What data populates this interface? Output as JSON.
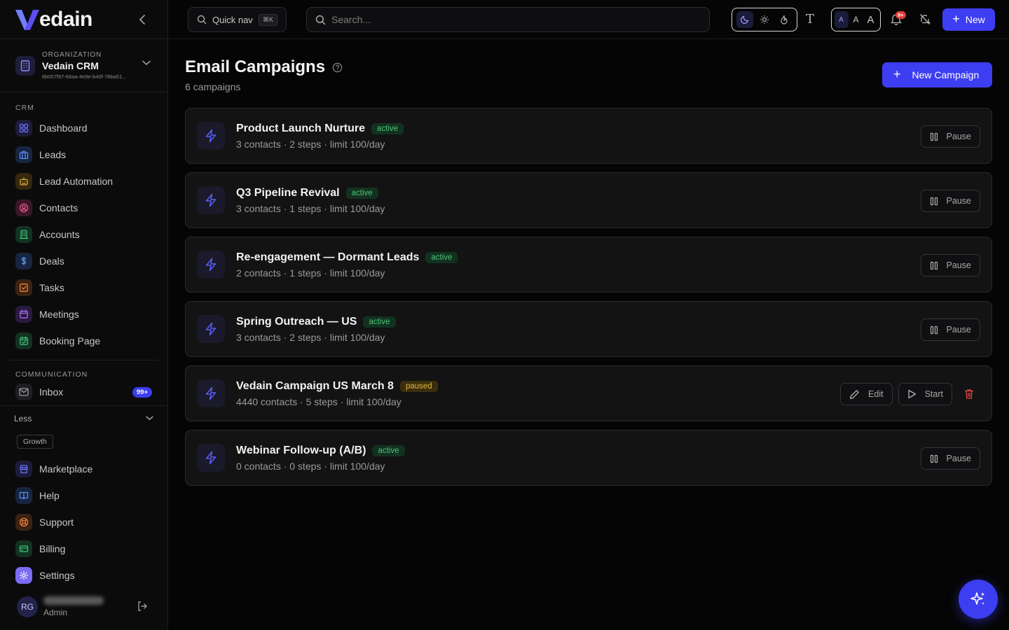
{
  "brand": {
    "logo_text": "edain"
  },
  "org": {
    "kicker": "ORGANIZATION",
    "name": "Vedain CRM",
    "id": "6b057f97-66aa-4e9e-b40f-78ba51..."
  },
  "sidebar": {
    "crm_label": "CRM",
    "crm_items": [
      {
        "label": "Dashboard",
        "icon": "dashboard-icon",
        "color": "#6b6ff5",
        "bg": "#1c1c3a"
      },
      {
        "label": "Leads",
        "icon": "briefcase-icon",
        "color": "#5b8def",
        "bg": "#172540"
      },
      {
        "label": "Lead Automation",
        "icon": "bot-icon",
        "color": "#e0a93a",
        "bg": "#35280e"
      },
      {
        "label": "Contacts",
        "icon": "contact-icon",
        "color": "#e05b8f",
        "bg": "#3a1726"
      },
      {
        "label": "Accounts",
        "icon": "building-icon",
        "color": "#3fc07d",
        "bg": "#123222"
      },
      {
        "label": "Deals",
        "icon": "dollar-icon",
        "color": "#5b9cf0",
        "bg": "#172540"
      },
      {
        "label": "Tasks",
        "icon": "task-icon",
        "color": "#f0803d",
        "bg": "#3a2212"
      },
      {
        "label": "Meetings",
        "icon": "calendar-icon",
        "color": "#a26bf0",
        "bg": "#2a1a40"
      },
      {
        "label": "Booking Page",
        "icon": "calendar-check-icon",
        "color": "#3fc07d",
        "bg": "#123222"
      }
    ],
    "comm_label": "COMMUNICATION",
    "inbox_label": "Inbox",
    "inbox_badge": "99+",
    "less_label": "Less",
    "growth_tag": "Growth",
    "more_items": [
      {
        "label": "Marketplace",
        "icon": "store-icon",
        "color": "#6b6ff5",
        "bg": "#1c1c3a"
      },
      {
        "label": "Help",
        "icon": "book-icon",
        "color": "#5b8def",
        "bg": "#172540"
      },
      {
        "label": "Support",
        "icon": "lifebuoy-icon",
        "color": "#f0803d",
        "bg": "#3a2212"
      },
      {
        "label": "Billing",
        "icon": "credit-card-icon",
        "color": "#3fc07d",
        "bg": "#123222"
      },
      {
        "label": "Settings",
        "icon": "gear-icon",
        "color": "#ffffff",
        "bg": "#7a6cf0"
      }
    ],
    "user": {
      "initials": "RG",
      "role": "Admin"
    }
  },
  "topbar": {
    "quicknav_label": "Quick nav",
    "quicknav_kbd": "⌘K",
    "search_placeholder": "Search...",
    "font_glyph": "T",
    "size_options": [
      "A",
      "A",
      "A"
    ],
    "bell_badge": "9+",
    "new_label": "New"
  },
  "page": {
    "title": "Email Campaigns",
    "subtitle": "6 campaigns",
    "new_campaign_label": "New Campaign"
  },
  "campaigns": [
    {
      "name": "Product Launch Nurture",
      "status": "active",
      "meta": "3 contacts · 2 steps · limit 100/day",
      "action": "Pause"
    },
    {
      "name": "Q3 Pipeline Revival",
      "status": "active",
      "meta": "3 contacts · 1 steps · limit 100/day",
      "action": "Pause"
    },
    {
      "name": "Re-engagement — Dormant Leads",
      "status": "active",
      "meta": "2 contacts · 1 steps · limit 100/day",
      "action": "Pause"
    },
    {
      "name": "Spring Outreach — US",
      "status": "active",
      "meta": "3 contacts · 2 steps · limit 100/day",
      "action": "Pause"
    },
    {
      "name": "Vedain Campaign US March 8",
      "status": "paused",
      "meta": "4440 contacts · 5 steps · limit 100/day",
      "edit": "Edit",
      "start": "Start"
    },
    {
      "name": "Webinar Follow-up (A/B)",
      "status": "active",
      "meta": "0 contacts · 0 steps · limit 100/day",
      "action": "Pause"
    }
  ],
  "colors": {
    "accent": "#3d3df2",
    "active": "#4fc37a",
    "paused": "#e0b540",
    "danger": "#e24848"
  }
}
